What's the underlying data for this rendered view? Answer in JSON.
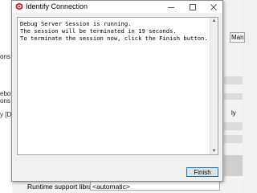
{
  "background": {
    "left_labels": [
      "ons",
      "ebols",
      "ons",
      "y [Di"
    ],
    "right_tab": "Manu",
    "right_text": "ly",
    "runtime_label": "Runtime support library:",
    "runtime_value": "<automatic>"
  },
  "dialog": {
    "title": "Identify Connection",
    "minimize_icon": "minimize-icon",
    "maximize_icon": "maximize-icon",
    "close_icon": "close-icon",
    "messages": [
      "Debug Server Session is running.",
      "The session will be terminated in 19 seconds.",
      "To terminate the session now, click the Finish button."
    ],
    "finish_label": "Finish",
    "accent_color": "#0078d7",
    "icon_color": "#d81e2a"
  }
}
